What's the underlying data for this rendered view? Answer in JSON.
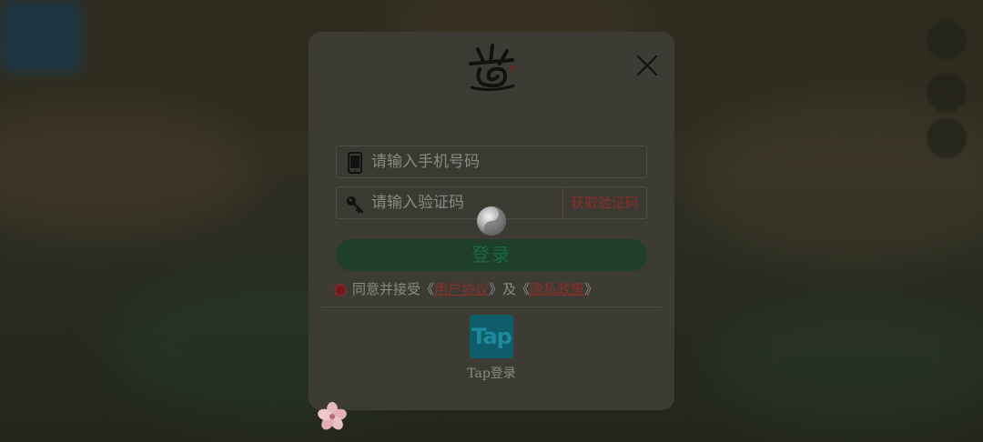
{
  "dialog": {
    "close_icon": "close-icon",
    "logo_icon": "game-logo-icon"
  },
  "phone": {
    "icon": "phone-icon",
    "placeholder": "请输入手机号码",
    "value": ""
  },
  "code": {
    "icon": "key-icon",
    "placeholder": "请输入验证码",
    "value": "",
    "get_code_label": "获取验证码"
  },
  "login": {
    "label": "登录"
  },
  "agreement": {
    "prefix": "同意并接受《",
    "user_agreement": "用户协议",
    "middle": "》及《",
    "privacy_policy": "隐私政策",
    "suffix": "》"
  },
  "third_party": {
    "tap_icon_text": "Tap",
    "tap_label": "Tap登录"
  },
  "colors": {
    "accent_red": "#8c2f2b",
    "login_green": "#1f3f2b",
    "tap_teal": "#0f5c6a"
  }
}
